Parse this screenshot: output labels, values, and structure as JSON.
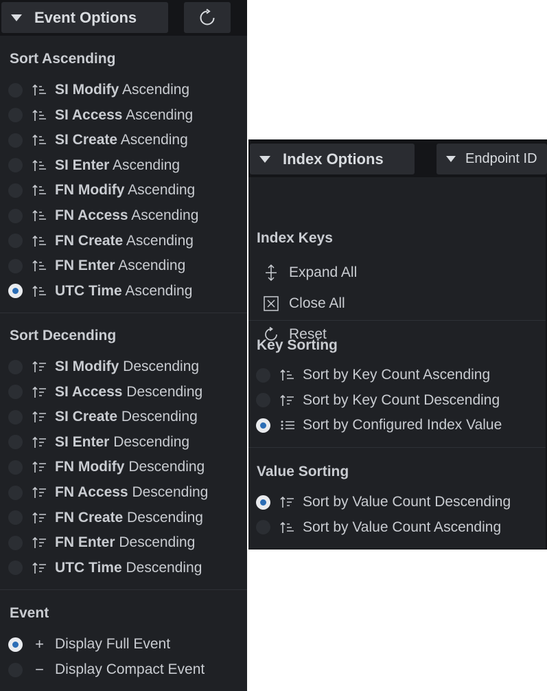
{
  "event_options": {
    "title": "Event Options",
    "refresh_icon": "refresh-icon",
    "sort_ascending": {
      "title": "Sort Ascending",
      "items": [
        {
          "bold": "SI Modify",
          "rest": " Ascending",
          "selected": false
        },
        {
          "bold": "SI Access",
          "rest": " Ascending",
          "selected": false
        },
        {
          "bold": "SI Create",
          "rest": " Ascending",
          "selected": false
        },
        {
          "bold": "SI Enter",
          "rest": " Ascending",
          "selected": false
        },
        {
          "bold": "FN Modify",
          "rest": " Ascending",
          "selected": false
        },
        {
          "bold": "FN Access",
          "rest": " Ascending",
          "selected": false
        },
        {
          "bold": "FN Create",
          "rest": " Ascending",
          "selected": false
        },
        {
          "bold": "FN Enter",
          "rest": " Ascending",
          "selected": false
        },
        {
          "bold": "UTC Time",
          "rest": " Ascending",
          "selected": true
        }
      ]
    },
    "sort_descending": {
      "title": "Sort Decending",
      "items": [
        {
          "bold": "SI Modify",
          "rest": " Descending",
          "selected": false
        },
        {
          "bold": "SI Access",
          "rest": " Descending",
          "selected": false
        },
        {
          "bold": "SI Create",
          "rest": " Descending",
          "selected": false
        },
        {
          "bold": "SI Enter",
          "rest": " Descending",
          "selected": false
        },
        {
          "bold": "FN Modify",
          "rest": " Descending",
          "selected": false
        },
        {
          "bold": "FN Access",
          "rest": " Descending",
          "selected": false
        },
        {
          "bold": "FN Create",
          "rest": " Descending",
          "selected": false
        },
        {
          "bold": "FN Enter",
          "rest": " Descending",
          "selected": false
        },
        {
          "bold": "UTC Time",
          "rest": " Descending",
          "selected": false
        }
      ]
    },
    "event": {
      "title": "Event",
      "items": [
        {
          "icon": "+",
          "label": "Display Full Event",
          "selected": true
        },
        {
          "icon": "−",
          "label": "Display Compact Event",
          "selected": false
        }
      ]
    }
  },
  "index_options": {
    "title": "Index Options",
    "endpoint_dropdown": "Endpoint ID",
    "index_keys": {
      "title": "Index Keys",
      "actions": [
        {
          "icon": "expand-icon",
          "label": "Expand All"
        },
        {
          "icon": "close-box-icon",
          "label": "Close All"
        },
        {
          "icon": "reset-icon",
          "label": "Reset"
        }
      ]
    },
    "key_sorting": {
      "title": "Key Sorting",
      "items": [
        {
          "icon": "sort-ascending-icon",
          "label": "Sort by Key Count Ascending",
          "selected": false
        },
        {
          "icon": "sort-descending-icon",
          "label": "Sort by Key Count Descending",
          "selected": false
        },
        {
          "icon": "list-icon",
          "label": "Sort by Configured Index Value",
          "selected": true
        }
      ]
    },
    "value_sorting": {
      "title": "Value Sorting",
      "items": [
        {
          "icon": "sort-descending-icon",
          "label": "Sort by Value Count Descending",
          "selected": true
        },
        {
          "icon": "sort-ascending-icon",
          "label": "Sort by Value Count Ascending",
          "selected": false
        }
      ]
    }
  },
  "colors": {
    "panel_bg": "#1f2125",
    "header_bg": "#141518",
    "button_bg": "#2a2c31",
    "text": "#c9ccd1",
    "radio_selected_dot": "#2b6db5"
  }
}
